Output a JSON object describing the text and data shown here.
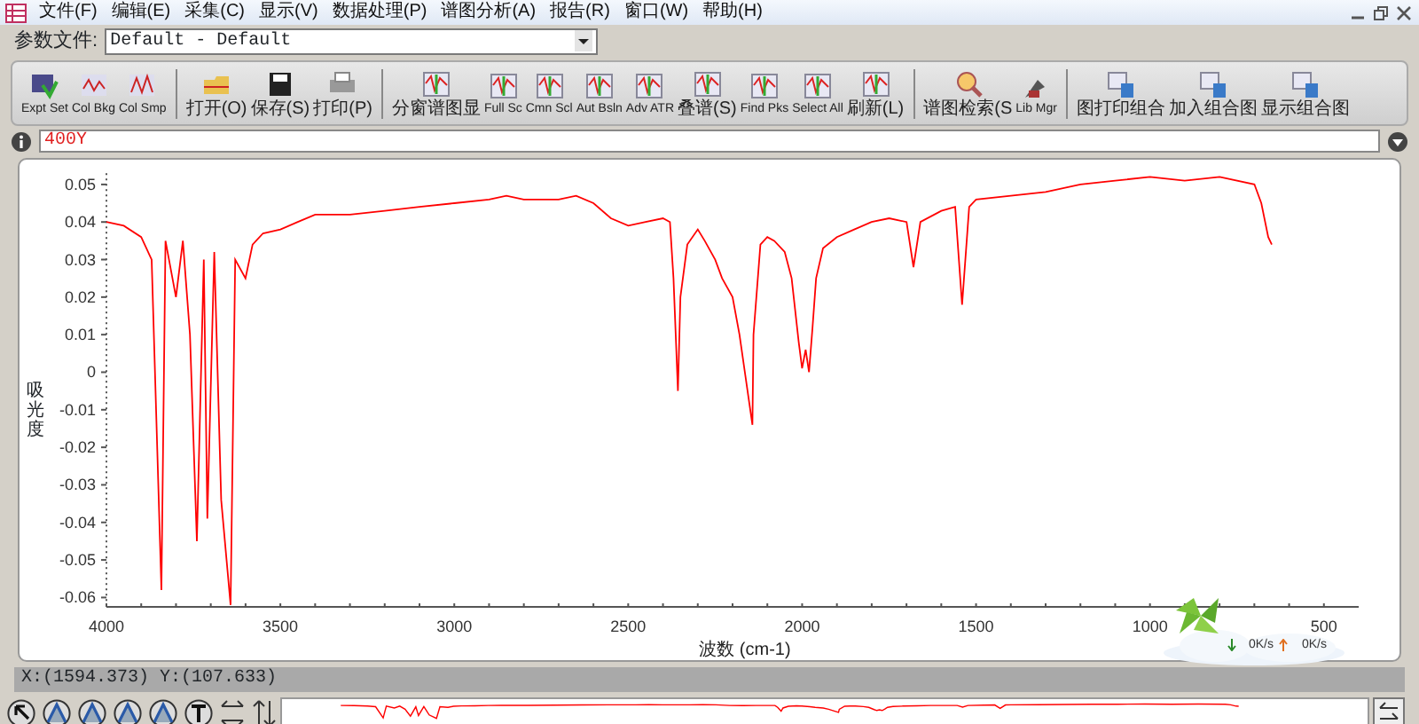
{
  "menu": [
    "文件(F)",
    "编辑(E)",
    "采集(C)",
    "显示(V)",
    "数据处理(P)",
    "谱图分析(A)",
    "报告(R)",
    "窗口(W)",
    "帮助(H)"
  ],
  "param_file": {
    "label": "参数文件:",
    "value": "Default - Default"
  },
  "toolbar": [
    {
      "kind": "button",
      "label": "Expt Set"
    },
    {
      "kind": "button",
      "label": "Col Bkg"
    },
    {
      "kind": "button",
      "label": "Col Smp"
    },
    {
      "kind": "separator"
    },
    {
      "kind": "button",
      "label": "打开(O)"
    },
    {
      "kind": "button",
      "label": "保存(S)"
    },
    {
      "kind": "button",
      "label": "打印(P)"
    },
    {
      "kind": "separator"
    },
    {
      "kind": "button",
      "label": "分窗谱图显"
    },
    {
      "kind": "button",
      "label": "Full Sc"
    },
    {
      "kind": "button",
      "label": "Cmn Scl"
    },
    {
      "kind": "button",
      "label": "Aut Bsln"
    },
    {
      "kind": "button",
      "label": "Adv ATR"
    },
    {
      "kind": "button",
      "label": "叠谱(S)"
    },
    {
      "kind": "button",
      "label": "Find Pks"
    },
    {
      "kind": "button",
      "label": "Select All"
    },
    {
      "kind": "button",
      "label": "刷新(L)"
    },
    {
      "kind": "separator"
    },
    {
      "kind": "button",
      "label": "谱图检索(S"
    },
    {
      "kind": "button",
      "label": "Lib Mgr"
    },
    {
      "kind": "separator"
    },
    {
      "kind": "button",
      "label": "图打印组合"
    },
    {
      "kind": "button",
      "label": "加入组合图"
    },
    {
      "kind": "button",
      "label": "显示组合图"
    }
  ],
  "chart_data": {
    "type": "line",
    "xlabel": "波数 (cm-1)",
    "ylabel": "吸光度",
    "x": [
      4000,
      3950,
      3900,
      3870,
      3842,
      3830,
      3800,
      3780,
      3760,
      3740,
      3720,
      3710,
      3690,
      3670,
      3643,
      3630,
      3600,
      3580,
      3550,
      3500,
      3450,
      3400,
      3300,
      3200,
      3100,
      3000,
      2900,
      2850,
      2800,
      2700,
      2650,
      2600,
      2550,
      2500,
      2450,
      2400,
      2380,
      2370,
      2357,
      2350,
      2330,
      2300,
      2280,
      2250,
      2230,
      2200,
      2180,
      2143,
      2140,
      2120,
      2100,
      2080,
      2050,
      2030,
      2010,
      2000,
      1990,
      1980,
      1970,
      1960,
      1940,
      1900,
      1850,
      1800,
      1750,
      1700,
      1680,
      1660,
      1600,
      1560,
      1540,
      1520,
      1500,
      1400,
      1300,
      1200,
      1100,
      1000,
      900,
      800,
      700,
      680,
      660,
      650
    ],
    "series": [
      {
        "name": "400Y",
        "color": "#ff0000",
        "values": [
          0.04,
          0.039,
          0.036,
          0.03,
          -0.058,
          0.035,
          0.02,
          0.035,
          0.01,
          -0.045,
          0.03,
          -0.039,
          0.032,
          -0.034,
          -0.062,
          0.03,
          0.025,
          0.034,
          0.037,
          0.038,
          0.04,
          0.042,
          0.042,
          0.043,
          0.044,
          0.045,
          0.046,
          0.047,
          0.046,
          0.046,
          0.047,
          0.045,
          0.041,
          0.039,
          0.04,
          0.041,
          0.04,
          0.025,
          -0.005,
          0.02,
          0.034,
          0.038,
          0.035,
          0.03,
          0.025,
          0.02,
          0.01,
          -0.014,
          0.01,
          0.034,
          0.036,
          0.035,
          0.032,
          0.025,
          0.008,
          0.001,
          0.006,
          0.0,
          0.012,
          0.025,
          0.033,
          0.036,
          0.038,
          0.04,
          0.041,
          0.04,
          0.028,
          0.04,
          0.043,
          0.044,
          0.018,
          0.044,
          0.046,
          0.047,
          0.048,
          0.05,
          0.051,
          0.052,
          0.051,
          0.052,
          0.05,
          0.045,
          0.036,
          0.034
        ]
      }
    ],
    "xlim": [
      4000,
      400
    ],
    "ylim": [
      -0.0625,
      0.053
    ],
    "xticks": [
      4000,
      3500,
      3000,
      2500,
      2000,
      1500,
      1000,
      500
    ],
    "yticks": [
      0.05,
      0.04,
      0.03,
      0.02,
      0.01,
      0,
      -0.01,
      -0.02,
      -0.03,
      -0.04,
      -0.05,
      -0.06
    ]
  },
  "speed_widget": {
    "down": "0K/s",
    "up": "0K/s"
  },
  "status": "X:(1594.373) Y:(107.633)"
}
